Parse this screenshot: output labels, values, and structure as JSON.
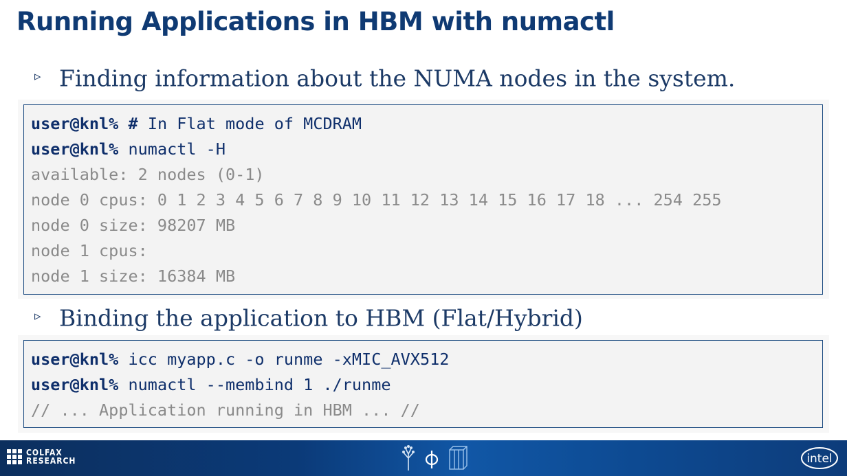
{
  "title": "Running Applications in HBM with numactl",
  "bullets": [
    {
      "marker": "▹",
      "text": "Finding information about the NUMA nodes in the system."
    },
    {
      "marker": "▹",
      "text": "Binding the application to HBM (Flat/Hybrid)"
    }
  ],
  "code_block_1": [
    {
      "prompt": "user@knl%",
      "hash": "#",
      "text": "In Flat mode of MCDRAM"
    },
    {
      "prompt": "user@knl%",
      "text": "numactl -H"
    },
    {
      "text": "available: 2 nodes (0-1)"
    },
    {
      "text": "node 0 cpus: 0 1 2 3 4 5 6 7 8 9 10 11 12 13 14 15 16 17 18 ... 254 255"
    },
    {
      "text": "node 0 size: 98207 MB"
    },
    {
      "text": "node 1 cpus:"
    },
    {
      "text": "node 1 size: 16384 MB"
    }
  ],
  "code_block_2": [
    {
      "prompt": "user@knl%",
      "text": "icc myapp.c -o runme -xMIC_AVX512"
    },
    {
      "prompt": "user@knl%",
      "text": "numactl --membind 1 ./runme"
    },
    {
      "text": "// ... Application running in HBM ... //"
    }
  ],
  "footer": {
    "logo_line1": "COLFAX",
    "logo_line2": "RESEARCH",
    "intel_logo": "intel"
  },
  "colors": {
    "title": "#0f3a73",
    "code_text": "#0f2f6b",
    "code_output": "#8a8a8a",
    "footer_bg": "#0b3a78"
  }
}
